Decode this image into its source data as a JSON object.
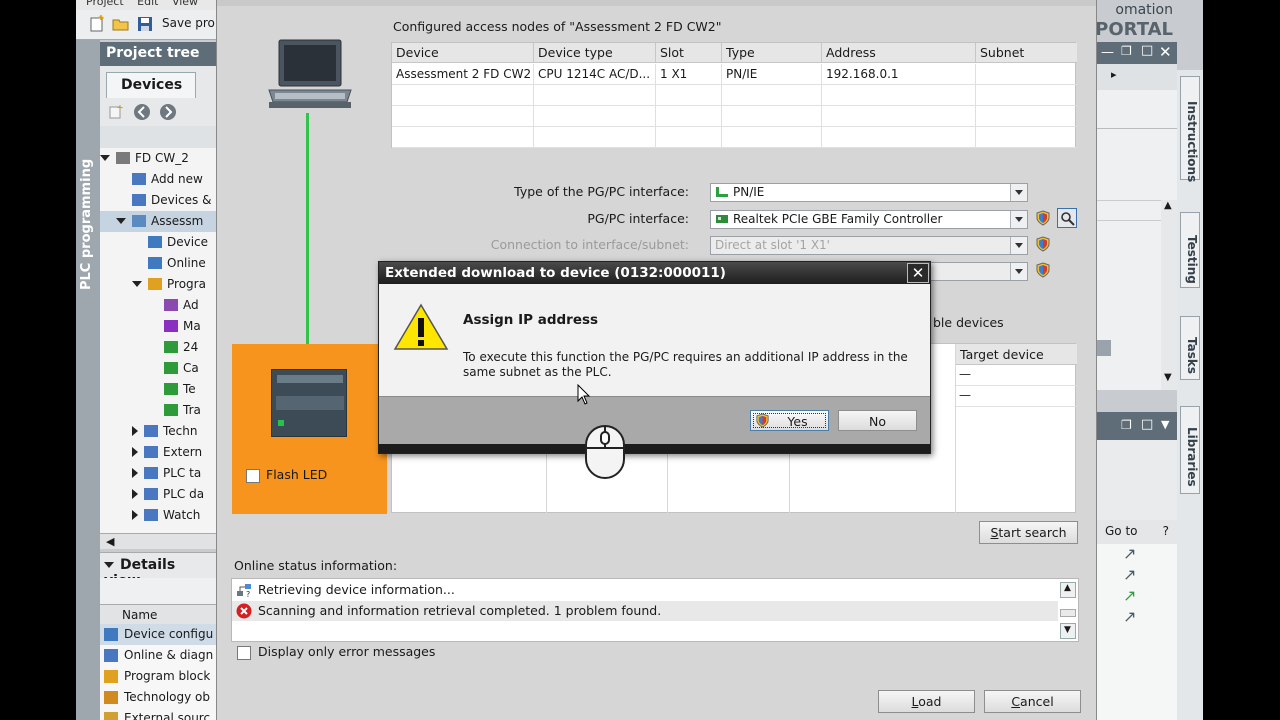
{
  "menubar": {
    "items": [
      "Project",
      "Edit",
      "View"
    ]
  },
  "toolbar": {
    "save_label": "Save pro"
  },
  "left": {
    "vertical_tab": "PLC programming",
    "project_tree_title": "Project tree",
    "devices_tab": "Devices",
    "tree": [
      {
        "label": "FD CW_2",
        "indent": 0,
        "arrow": "down"
      },
      {
        "label": "Add new",
        "indent": 1,
        "arrow": ""
      },
      {
        "label": "Devices &",
        "indent": 1,
        "arrow": ""
      },
      {
        "label": "Assessm",
        "indent": 1,
        "arrow": "down",
        "selected": true
      },
      {
        "label": "Device",
        "indent": 2,
        "arrow": ""
      },
      {
        "label": "Online",
        "indent": 2,
        "arrow": ""
      },
      {
        "label": "Progra",
        "indent": 2,
        "arrow": "down"
      },
      {
        "label": "Ad",
        "indent": 3,
        "arrow": ""
      },
      {
        "label": "Ma",
        "indent": 3,
        "arrow": ""
      },
      {
        "label": "24",
        "indent": 3,
        "arrow": ""
      },
      {
        "label": "Ca",
        "indent": 3,
        "arrow": ""
      },
      {
        "label": "Te",
        "indent": 3,
        "arrow": ""
      },
      {
        "label": "Tra",
        "indent": 3,
        "arrow": ""
      },
      {
        "label": "Techn",
        "indent": 2,
        "arrow": "right"
      },
      {
        "label": "Extern",
        "indent": 2,
        "arrow": "right"
      },
      {
        "label": "PLC ta",
        "indent": 2,
        "arrow": "right"
      },
      {
        "label": "PLC da",
        "indent": 2,
        "arrow": "right"
      },
      {
        "label": "Watch",
        "indent": 2,
        "arrow": "right"
      }
    ],
    "details_title": "Details view",
    "details_name_header": "Name",
    "details_items": [
      "Device configu",
      "Online & diagn",
      "Program block",
      "Technology ob",
      "External sourc"
    ]
  },
  "right": {
    "brand_line1": "omation",
    "brand_line2": "PORTAL",
    "goto_label": "Go to",
    "goto_help": "?",
    "vertical_tabs": [
      "Instructions",
      "Testing",
      "Tasks",
      "Libraries"
    ]
  },
  "download": {
    "access_nodes_title": "Configured access nodes of \"Assessment 2 FD CW2\"",
    "columns": [
      "Device",
      "Device type",
      "Slot",
      "Type",
      "Address",
      "Subnet"
    ],
    "rows": [
      [
        "Assessment 2 FD CW2",
        "CPU 1214C AC/D...",
        "1 X1",
        "PN/IE",
        "192.168.0.1",
        ""
      ]
    ],
    "pgpc_type_label": "Type of the PG/PC interface:",
    "pgpc_type_value": "PN/IE",
    "pgpc_interface_label": "PG/PC interface:",
    "pgpc_interface_value": "Realtek PCIe GBE Family Controller",
    "connection_label": "Connection to interface/subnet:",
    "connection_value": "Direct at slot '1 X1'",
    "compatible_devices_fragment": "ble devices",
    "target_device_header": "Target device",
    "target_dashes": [
      "—",
      "—"
    ],
    "flash_led_label": "Flash LED",
    "start_search_label": "Start search",
    "online_status_label": "Online status information:",
    "status_messages": [
      {
        "text": "Retrieving device information...",
        "kind": "info"
      },
      {
        "text": "Scanning and information retrieval completed. 1 problem found.",
        "kind": "error"
      }
    ],
    "display_errors_label": "Display only error messages",
    "load_label": "Load",
    "cancel_label": "Cancel"
  },
  "popup": {
    "title": "Extended download to device (0132:000011)",
    "heading": "Assign IP address",
    "message": "To execute this function the PG/PC requires an additional IP address in the same subnet as the PLC.",
    "yes_label": "Yes",
    "no_label": "No",
    "close_glyph": "✕"
  },
  "colors": {
    "plc_highlight": "#f7941d",
    "connection_line": "#31c44a",
    "title_bar": "#5e6d78",
    "warning_yellow": "#ffe600",
    "error_red": "#d42020"
  }
}
